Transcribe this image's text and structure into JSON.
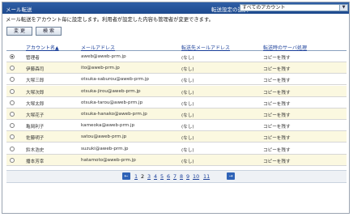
{
  "window": {
    "title": "メール転送"
  },
  "selector": {
    "label": "転送設定の選択 :",
    "value": "すべてのアカウント"
  },
  "description": "メール転送をアカウント毎に設定します。利用者が設定した内容も管理者が変更できます。",
  "buttons": {
    "change": "変 更",
    "search": "検 索"
  },
  "table": {
    "headers": [
      "アカウント名▲",
      "メールアドレス",
      "転送先メールアドレス",
      "転送時のサーバ処理"
    ],
    "rows": [
      {
        "name": "管理者",
        "email": "aweb@aweb-prm.jp",
        "forward": "(なし)",
        "server": "コピーを残す",
        "selected": true
      },
      {
        "name": "伊藤森司",
        "email": "ito@aweb-prm.jp",
        "forward": "(なし)",
        "server": "コピーを残す",
        "selected": false
      },
      {
        "name": "大塚三郎",
        "email": "otsuka-saburou@aweb-prm.jp",
        "forward": "(なし)",
        "server": "コピーを残す",
        "selected": false
      },
      {
        "name": "大塚次郎",
        "email": "otsuka-jirou@aweb-prm.jp",
        "forward": "(なし)",
        "server": "コピーを残す",
        "selected": false
      },
      {
        "name": "大塚太郎",
        "email": "otsuka-tarou@aweb-prm.jp",
        "forward": "(なし)",
        "server": "コピーを残す",
        "selected": false
      },
      {
        "name": "大塚花子",
        "email": "otsuka-hanako@aweb-prm.jp",
        "forward": "(なし)",
        "server": "コピーを残す",
        "selected": false
      },
      {
        "name": "亀岡利子",
        "email": "kameoka@aweb-prm.jp",
        "forward": "(なし)",
        "server": "コピーを残す",
        "selected": false
      },
      {
        "name": "佐藤明子",
        "email": "satou@aweb-prm.jp",
        "forward": "(なし)",
        "server": "コピーを残す",
        "selected": false
      },
      {
        "name": "鈴木浩史",
        "email": "suzuki@aweb-prm.jp",
        "forward": "(なし)",
        "server": "コピーを残す",
        "selected": false
      },
      {
        "name": "播本芳幸",
        "email": "hatamoto@aweb-prm.jp",
        "forward": "(なし)",
        "server": "コピーを残す",
        "selected": false
      }
    ]
  },
  "pager": {
    "prev": "←",
    "next": "→",
    "pages": [
      "1",
      "2",
      "3",
      "4",
      "5",
      "6",
      "7",
      "8",
      "9",
      "10",
      "11"
    ],
    "current": "2"
  }
}
